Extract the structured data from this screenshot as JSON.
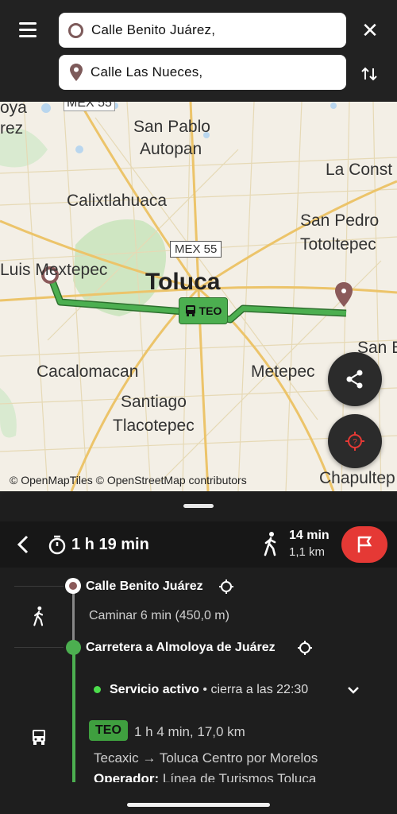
{
  "search": {
    "origin_value": "Calle Benito Juárez,",
    "destination_value": "Calle Las Nueces,"
  },
  "map": {
    "labels": {
      "mex_top": "MEX 55",
      "yoya": "oya",
      "rez": "rez",
      "san_pablo": "San Pablo",
      "autopan": "Autopan",
      "la_const": "La Const",
      "calixtlahuaca": "Calixtlahuaca",
      "san_pedro": "San Pedro",
      "totoltepec": "Totoltepec",
      "mex55": "MEX 55",
      "luis_mextepec": "Luis Mextepec",
      "toluca": "Toluca",
      "san_b": "San B",
      "cacalomacan": "Cacalomacan",
      "metepec": "Metepec",
      "santiago": "Santiago",
      "tlacotepec": "Tlacotepec",
      "chapultep": "Chapultep"
    },
    "route_badge": "TEO",
    "attribution": "© OpenMapTiles © OpenStreetMap contributors",
    "route_color": "#3f9f3f"
  },
  "route": {
    "duration": "1 h 19 min",
    "walk_time": "14 min",
    "walk_distance": "1,1 km"
  },
  "itinerary": {
    "start_stop": "Calle Benito Juárez",
    "walk_text": "Caminar 6 min (450,0 m)",
    "transfer_stop": "Carretera a Almoloya de Juárez",
    "service_status": "Servicio activo",
    "service_closing": " • cierra a las 22:30",
    "line_badge": "TEO",
    "line_info": "1 h 4 min, 17,0 km",
    "line_direction": "Tecaxic → Toluca Centro por Morelos",
    "operator_label": "Operador:",
    "operator_name": " Línea de Turismos Toluca"
  }
}
